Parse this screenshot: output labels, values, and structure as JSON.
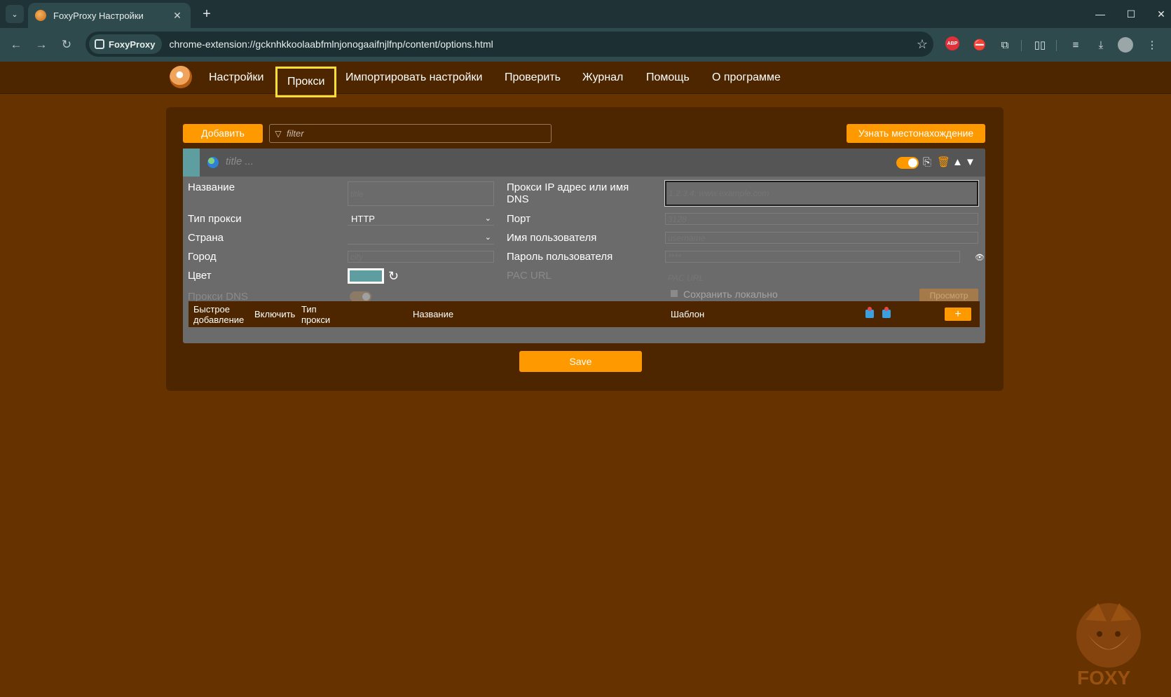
{
  "browser": {
    "tab_title": "FoxyProxy Настройки",
    "tab_close": "✕",
    "new_tab": "+",
    "site_chip": "FoxyProxy",
    "url": "chrome-extension://gcknhkkoolaabfmlnjonogaaifnjlfnp/content/options.html",
    "abp_label": "ABP"
  },
  "nav": {
    "items": [
      "Настройки",
      "Прокси",
      "Импортировать настройки",
      "Проверить",
      "Журнал",
      "Помощь",
      "О программе"
    ],
    "active": "Прокси"
  },
  "toolbar": {
    "add_label": "Добавить",
    "filter_placeholder": "filter",
    "location_label": "Узнать местонахождение"
  },
  "proxy": {
    "header_title": "title ...",
    "accent_color": "#5f9ea0",
    "enabled": true,
    "labels": {
      "title": "Название",
      "proxy_type": "Тип прокси",
      "country": "Страна",
      "city": "Город",
      "color": "Цвет",
      "proxy_dns": "Прокси DNS",
      "hostname": "Прокси IP адрес или имя DNS",
      "port": "Порт",
      "username": "Имя пользователя",
      "password": "Пароль пользователя",
      "pac_url": "PAC URL",
      "store_locally": "Сохранить локально",
      "view": "Просмотр"
    },
    "placeholders": {
      "title": "title",
      "city": "city",
      "hostname": "1.2.3.4, www.example.com",
      "port": "3128",
      "username": "username",
      "password": "****",
      "pac_url": "PAC URL"
    },
    "values": {
      "proxy_type": "HTTP",
      "country": ""
    }
  },
  "quick_add": {
    "columns": {
      "quick_add": "Быстрое добавление",
      "include": "Включить",
      "type": "Тип прокси",
      "title": "Название",
      "pattern": "Шаблон"
    },
    "add_label": "+"
  },
  "save_label": "Save",
  "watermark_text": "FOXY"
}
